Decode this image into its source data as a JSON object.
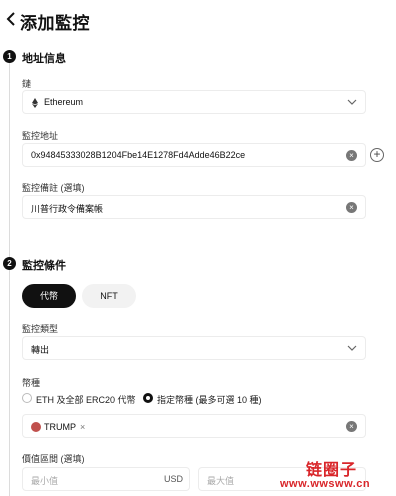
{
  "header": {
    "title": "添加監控"
  },
  "steps": [
    {
      "number": "1",
      "title": "地址信息"
    },
    {
      "number": "2",
      "title": "監控條件"
    }
  ],
  "chain": {
    "label": "鏈",
    "value": "Ethereum"
  },
  "address": {
    "label": "監控地址",
    "value": "0x94845333028B1204Fbe14E1278Fd4Adde46B22ce"
  },
  "remark": {
    "label": "監控備註 (選填)",
    "value": "川普行政令備案帳"
  },
  "asset_tabs": {
    "token": "代幣",
    "nft": "NFT"
  },
  "monitor_type": {
    "label": "監控類型",
    "value": "轉出"
  },
  "tokens": {
    "label": "幣種",
    "option_all": "ETH 及全部 ERC20 代幣",
    "option_specific": "指定幣種 (最多可選 10 種)",
    "selected": [
      "TRUMP"
    ]
  },
  "price_range": {
    "label": "價值區間 (選填)",
    "min_placeholder": "最小值",
    "unit": "USD",
    "max_placeholder": "最大值"
  },
  "watermark": {
    "title": "链圈子",
    "url": "www.wwsww.cn"
  },
  "colors": {
    "accent": "#111111",
    "watermark": "#d9262a",
    "border": "#ececec"
  }
}
